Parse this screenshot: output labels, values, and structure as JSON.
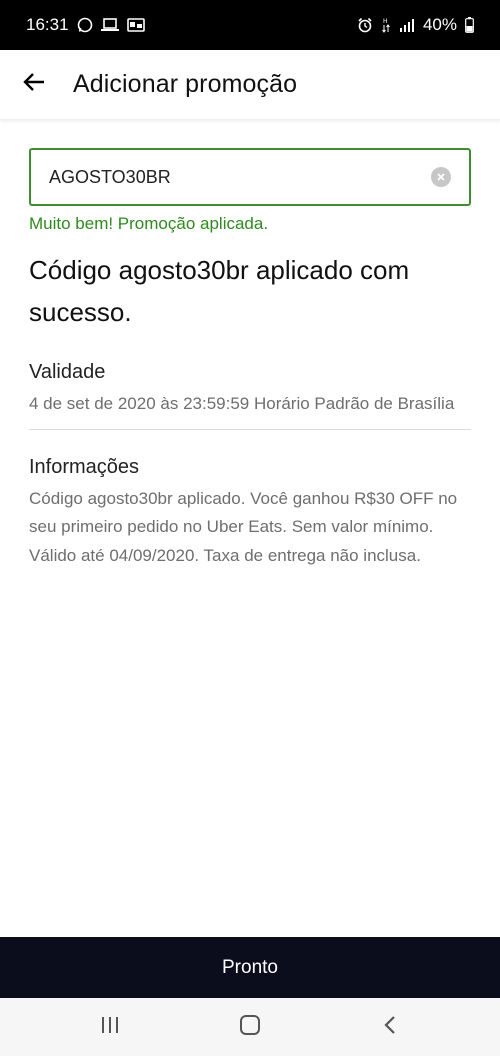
{
  "status_bar": {
    "time": "16:31",
    "battery": "40%",
    "left_icons": [
      "whatsapp-icon",
      "laptop-icon",
      "card-icon"
    ],
    "right_icons": [
      "alarm-icon",
      "data-arrows-icon",
      "signal-icon",
      "battery-icon"
    ]
  },
  "header": {
    "title": "Adicionar promoção",
    "back_icon": "arrow-left-icon"
  },
  "promo": {
    "value": "AGOSTO30BR",
    "clear_icon": "clear-circle-icon",
    "success_message": "Muito bem! Promoção aplicada."
  },
  "headline": "Código agosto30br aplicado com sucesso.",
  "validity": {
    "label": "Validade",
    "text": "4 de set de 2020 às 23:59:59 Horário Padrão de Brasília"
  },
  "info": {
    "label": "Informações",
    "text": "Código agosto30br aplicado. Você ganhou R$30 OFF no seu primeiro pedido no Uber Eats. Sem valor mínimo. Válido até 04/09/2020. Taxa de entrega não inclusa."
  },
  "done_button": {
    "label": "Pronto"
  },
  "nav": {
    "icons": [
      "recent-apps-icon",
      "home-icon",
      "back-icon"
    ]
  },
  "colors": {
    "accent_green": "#3e8f2e",
    "success_text": "#2f8a1f",
    "button_bg": "#0b0c1c",
    "status_bar_bg": "#000000"
  }
}
